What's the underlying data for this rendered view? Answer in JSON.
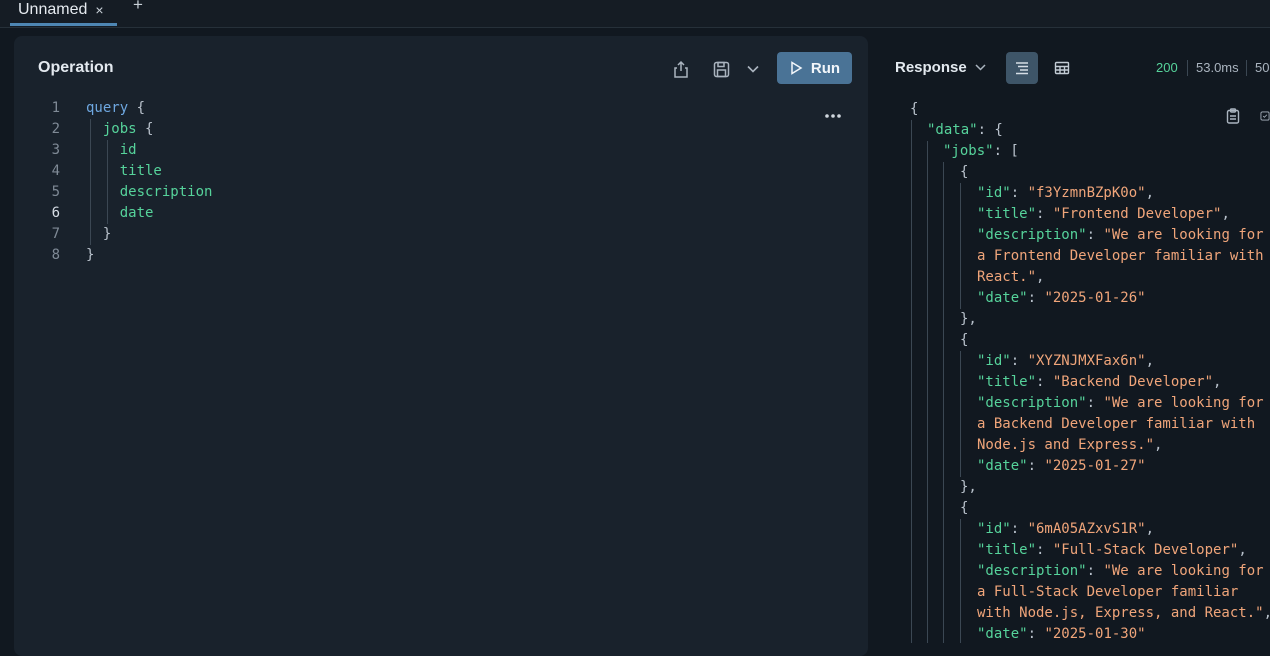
{
  "tabs": [
    {
      "label": "Unnamed",
      "close": "×",
      "active": true
    }
  ],
  "new_tab": "+",
  "operation": {
    "title": "Operation",
    "run_label": "Run",
    "lines": [
      {
        "n": "1",
        "text": "query {"
      },
      {
        "n": "2",
        "text": "jobs {"
      },
      {
        "n": "3",
        "text": "id"
      },
      {
        "n": "4",
        "text": "title"
      },
      {
        "n": "5",
        "text": "description"
      },
      {
        "n": "6",
        "text": "date",
        "active": true
      },
      {
        "n": "7",
        "text": "}"
      },
      {
        "n": "8",
        "text": "}"
      }
    ],
    "query_keyword": "query",
    "open_brace": "{",
    "close_brace": "}",
    "jobs_field": "jobs",
    "fields": [
      "id",
      "title",
      "description",
      "date"
    ]
  },
  "response": {
    "label": "Response",
    "status": "200",
    "time": "53.0ms",
    "size_truncated": "50",
    "json": {
      "open": "{",
      "data_key": "\"data\"",
      "jobs_key": "\"jobs\"",
      "items": [
        {
          "id": "\"f3YzmnBZpK0o\"",
          "title": "\"Frontend Developer\"",
          "description_lines": [
            "\"We are looking for",
            "a Frontend Developer familiar with",
            "React.\""
          ],
          "date": "\"2025-01-26\""
        },
        {
          "id": "\"XYZNJMXFax6n\"",
          "title": "\"Backend Developer\"",
          "description_lines": [
            "\"We are looking for",
            "a Backend Developer familiar with",
            "Node.js and Express.\""
          ],
          "date": "\"2025-01-27\""
        },
        {
          "id": "\"6mA05AZxvS1R\"",
          "title": "\"Full-Stack Developer\"",
          "description_lines": [
            "\"We are looking for",
            "a Full-Stack Developer familiar",
            "with Node.js, Express, and React.\""
          ],
          "date": "\"2025-01-30\""
        }
      ],
      "keys": {
        "id": "\"id\"",
        "title": "\"title\"",
        "description": "\"description\"",
        "date": "\"date\""
      }
    }
  },
  "colors": {
    "background": "#111820",
    "panel": "#19222c",
    "run_button": "#4a7396",
    "key_green": "#56d39b",
    "string_orange": "#f0a57a",
    "keyword_blue": "#6ea7e0"
  },
  "icons": [
    "share-icon",
    "save-icon",
    "chevron-down-icon",
    "play-icon",
    "more-horizontal-icon",
    "list-view-icon",
    "table-view-icon",
    "copy-icon",
    "save-response-icon"
  ]
}
